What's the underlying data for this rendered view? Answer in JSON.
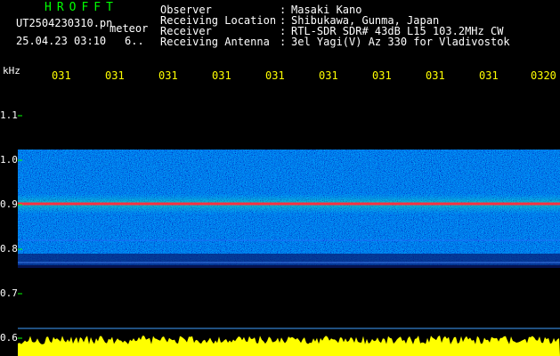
{
  "header": {
    "app_name": "HROFFT",
    "file_name": "UT2504230310.pn",
    "mode": "meteor",
    "date_time": "25.04.23 03:10",
    "rate": "6..",
    "fields": [
      {
        "label": "Observer",
        "value": "Masaki Kano"
      },
      {
        "label": "Receiving Location",
        "value": "Shibukawa, Gunma, Japan"
      },
      {
        "label": "Receiver",
        "value": "RTL-SDR SDR# 43dB L15 103.2MHz CW"
      },
      {
        "label": "Receiving Antenna",
        "value": "3el Yagi(V) Az 330 for Vladivostok"
      }
    ]
  },
  "axis": {
    "unit": "kHz",
    "freq_ticks": [
      "1.1",
      "1.0",
      "0.9",
      "0.8",
      "0.7",
      "0.6"
    ],
    "time_ticks": [
      "031",
      "031",
      "031",
      "031",
      "031",
      "031",
      "031",
      "031",
      "031",
      "0320"
    ]
  },
  "colors": {
    "header_app": "#00ff00",
    "text": "#ffffff",
    "time_labels": "#ffff00",
    "tick_lines": "#00ff00",
    "signal_line": "#ff3040",
    "noise_band": "#0a2a9a",
    "level_fill": "#ffff00"
  }
}
